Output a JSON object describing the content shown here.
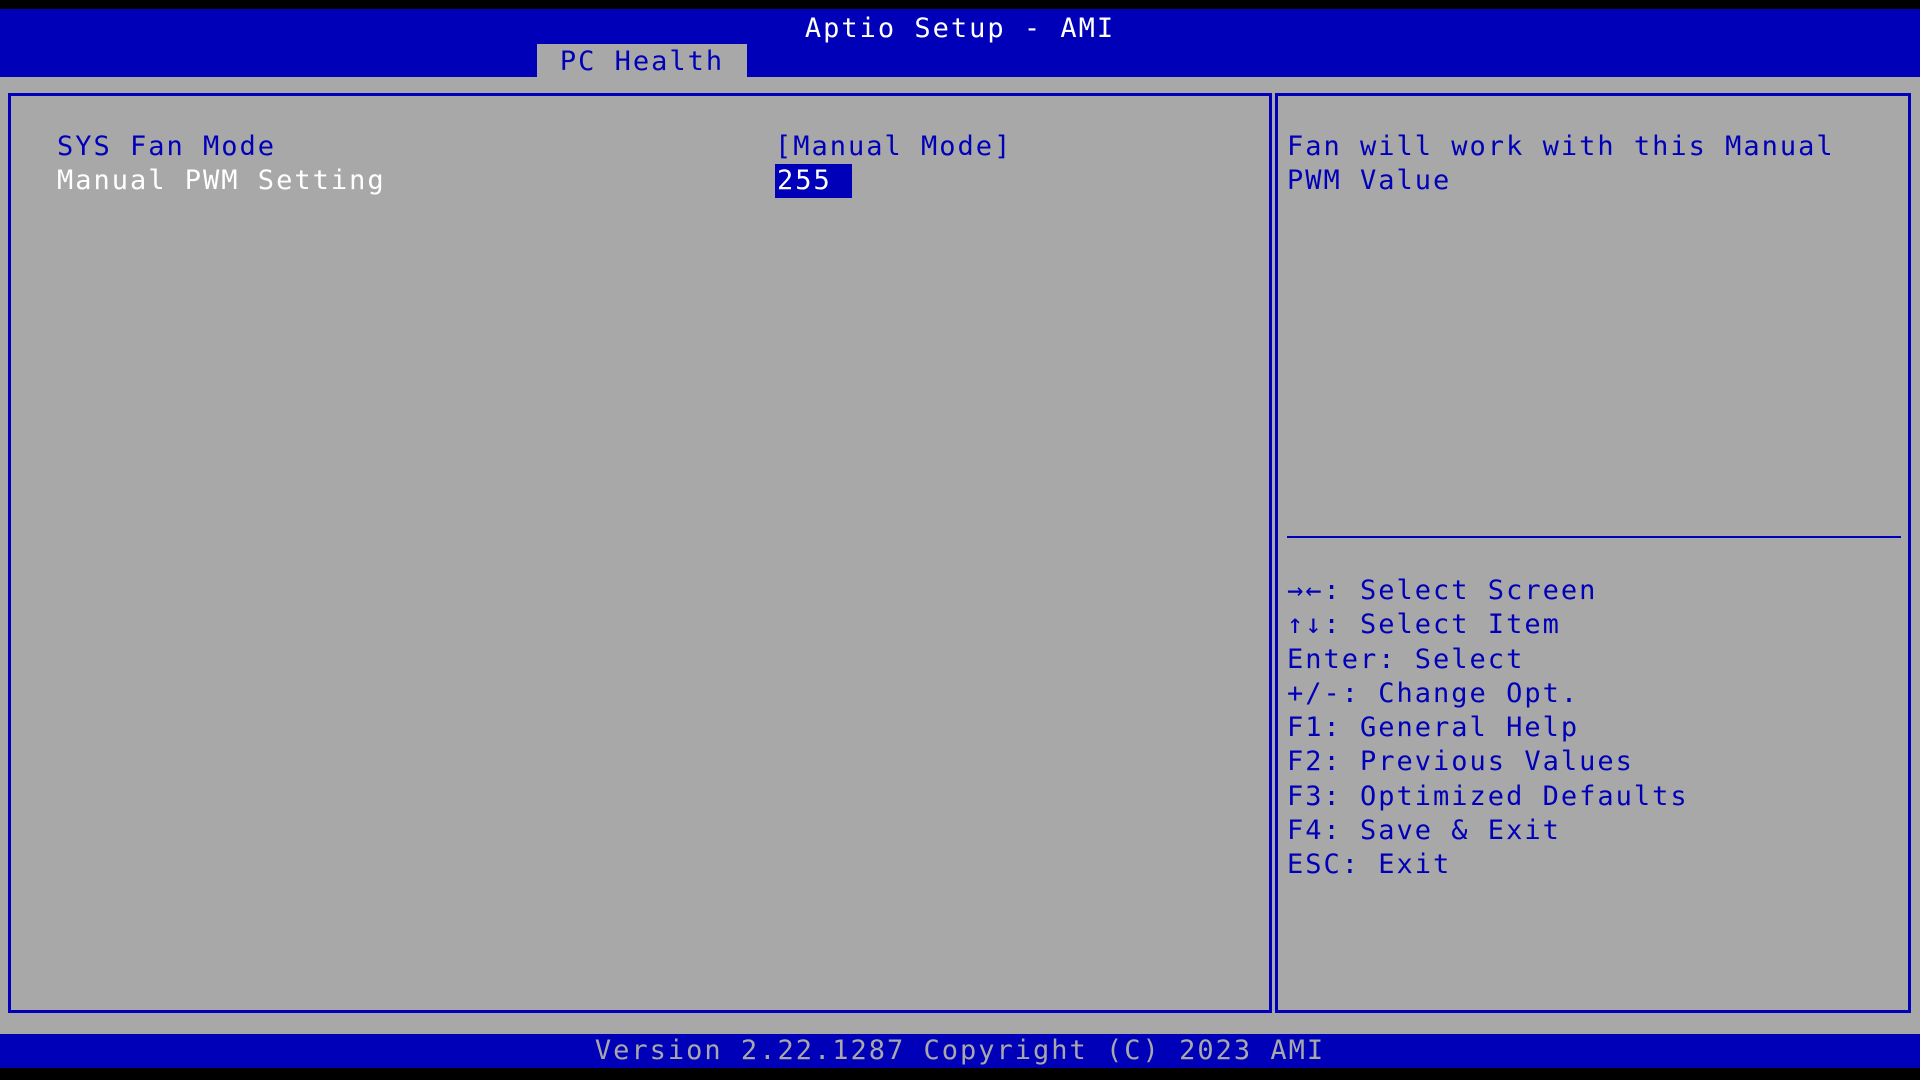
{
  "header": {
    "title": "Aptio Setup - AMI",
    "active_tab": "PC Health"
  },
  "settings": [
    {
      "label": "SYS Fan Mode",
      "value": "[Manual Mode]"
    },
    {
      "label": "Manual PWM Setting",
      "value": "255"
    }
  ],
  "help": {
    "text": "Fan will work with this Manual PWM Value",
    "keys": [
      "→←: Select Screen",
      "↑↓: Select Item",
      "Enter: Select",
      "+/-: Change Opt.",
      "F1: General Help",
      "F2: Previous Values",
      "F3: Optimized Defaults",
      "F4: Save & Exit",
      "ESC: Exit"
    ]
  },
  "footer": {
    "text": "Version 2.22.1287 Copyright (C) 2023 AMI"
  },
  "colors": {
    "blue": "#0000b8",
    "gray": "#a8a8a8",
    "white": "#ffffff"
  }
}
